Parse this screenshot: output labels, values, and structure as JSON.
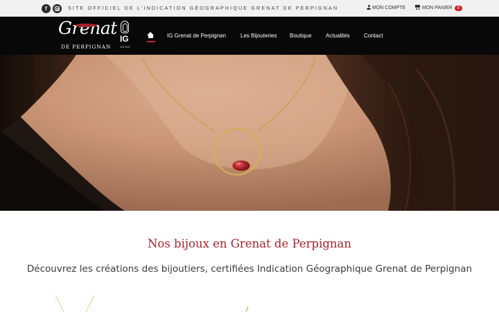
{
  "topbar": {
    "social": [
      {
        "icon": "facebook-icon",
        "glyph": "f"
      },
      {
        "icon": "instagram-icon"
      }
    ],
    "tagline": "SITE OFFICIEL DE L'INDICATION GÉOGRAPHIQUE GRENAT DE PERPIGNAN",
    "account_label": "MON COMPTE",
    "cart_label": "MON PANIER",
    "cart_count": "0"
  },
  "logo": {
    "script": "Grenat",
    "sub": "DE PERPIGNAN",
    "ig_text": "IG",
    "ig_small": "IGN 2021"
  },
  "nav": {
    "home_icon": "home-icon",
    "items": [
      "IG Grenat de Perpignan",
      "Les Bijouteries",
      "Boutique",
      "Actualités",
      "Contact"
    ]
  },
  "main": {
    "heading": "Nos bijoux en Grenat de Perpignan",
    "subheading": "Découvrez les créations des bijoutiers, certifiées Indication Géographique Grenat de Perpignan"
  },
  "colors": {
    "accent": "#a8222b",
    "nav_bg": "#080808",
    "topbar_bg": "#f1f1f1",
    "badge": "#c2272d"
  }
}
